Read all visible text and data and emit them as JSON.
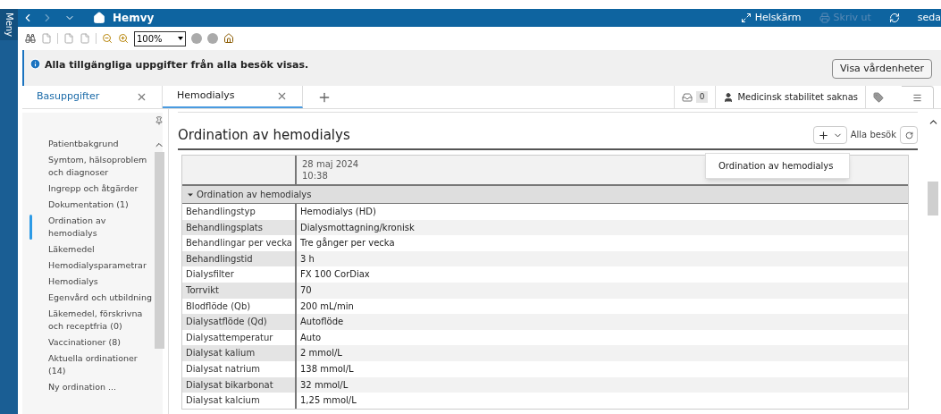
{
  "side_menu": {
    "label": "Meny"
  },
  "top_bar": {
    "title": "Hemvy",
    "actions": [
      {
        "kind": "fullscreen",
        "label": "Helskärm",
        "disabled": false
      },
      {
        "kind": "print",
        "label": "Skriv ut",
        "disabled": true
      }
    ],
    "user": "seda"
  },
  "toolbar": {
    "zoom": "100%"
  },
  "banner": {
    "message": "Alla tillgängliga uppgifter från alla besök visas.",
    "button": "Visa vårdenheter"
  },
  "tabs": [
    {
      "label": "Basuppgifter",
      "selected": false
    },
    {
      "label": "Hemodialys",
      "selected": true
    }
  ],
  "status": {
    "count": "0",
    "stability": "Medicinsk stabilitet saknas"
  },
  "sidebar": {
    "items": [
      {
        "label": "Patientbakgrund",
        "selected": false
      },
      {
        "label": "Symtom, hälsoproblem och diagnoser",
        "selected": false
      },
      {
        "label": "Ingrepp och åtgärder",
        "selected": false
      },
      {
        "label": "Dokumentation (1)",
        "selected": false
      },
      {
        "label": "Ordination av hemodialys",
        "selected": true
      },
      {
        "label": "Läkemedel",
        "selected": false
      },
      {
        "label": "Hemodialysparametrar",
        "selected": false
      },
      {
        "label": "Hemodialys",
        "selected": false
      },
      {
        "label": "Egenvård och utbildning",
        "selected": false
      },
      {
        "label": "Läkemedel, förskrivna och receptfria (0)",
        "selected": false
      },
      {
        "label": "Vaccinationer (8)",
        "selected": false
      },
      {
        "label": "Aktuella ordinationer (14)",
        "selected": false
      },
      {
        "label": "Ny ordination ...",
        "selected": false
      }
    ]
  },
  "section": {
    "title": "Ordination av hemodialys",
    "filter": "Alla besök",
    "menu": [
      "Ordination av hemodialys"
    ]
  },
  "table": {
    "date": "28 maj 2024",
    "time": "10:38",
    "group": {
      "label": "Ordination av hemodialys",
      "expanded": true
    },
    "rows": [
      {
        "label": "Behandlingstyp",
        "value": "Hemodialys (HD)"
      },
      {
        "label": "Behandlingsplats",
        "value": "Dialysmottagning/kronisk"
      },
      {
        "label": "Behandlingar per vecka",
        "value": "Tre gånger per vecka"
      },
      {
        "label": "Behandlingstid",
        "value": "3 h"
      },
      {
        "label": "Dialysfilter",
        "value": "FX 100 CorDiax"
      },
      {
        "label": "Torrvikt",
        "value": "70"
      },
      {
        "label": "Blodflöde (Qb)",
        "value": "200 mL/min"
      },
      {
        "label": "Dialysatflöde (Qd)",
        "value": "Autoflöde"
      },
      {
        "label": "Dialysattemperatur",
        "value": "Auto"
      },
      {
        "label": "Dialysat kalium",
        "value": "2 mmol/L"
      },
      {
        "label": "Dialysat natrium",
        "value": "138 mmol/L"
      },
      {
        "label": "Dialysat bikarbonat",
        "value": "32 mmol/L"
      },
      {
        "label": "Dialysat kalcium",
        "value": "1,25 mmol/L"
      }
    ]
  }
}
